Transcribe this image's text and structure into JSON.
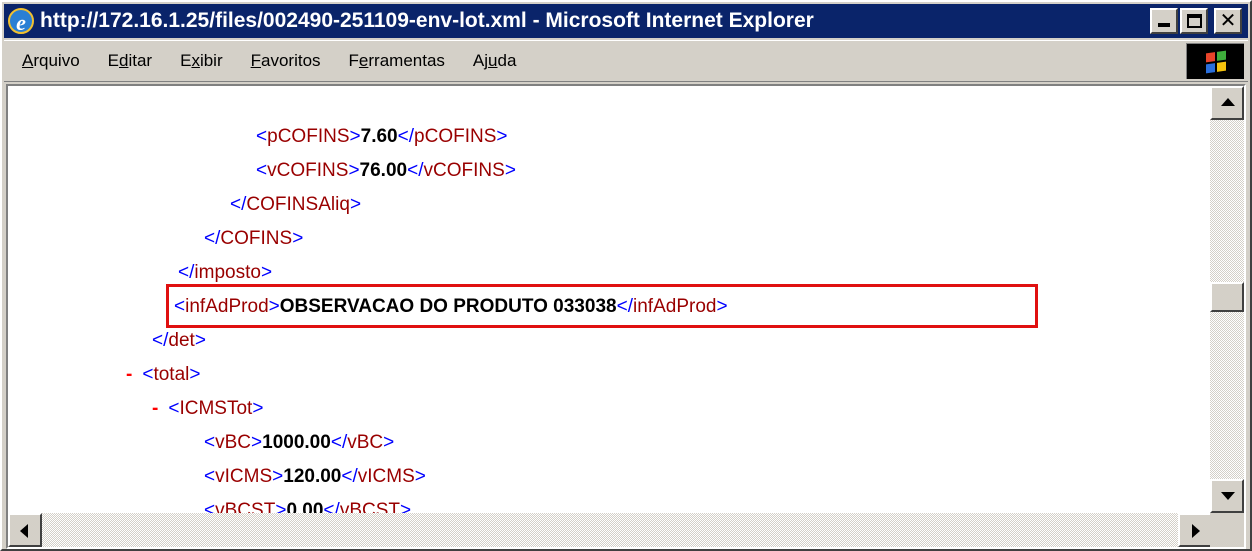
{
  "window": {
    "title": "http://172.16.1.25/files/002490-251109-env-lot.xml - Microsoft Internet Explorer"
  },
  "menu": {
    "items": [
      {
        "pre": "",
        "key": "A",
        "post": "rquivo"
      },
      {
        "pre": "E",
        "key": "d",
        "post": "itar"
      },
      {
        "pre": "E",
        "key": "x",
        "post": "ibir"
      },
      {
        "pre": "",
        "key": "F",
        "post": "avoritos"
      },
      {
        "pre": "F",
        "key": "e",
        "post": "rramentas"
      },
      {
        "pre": "Aj",
        "key": "u",
        "post": "da"
      }
    ]
  },
  "xml": {
    "pcofins": {
      "open": "<pCOFINS>",
      "value": "7.60",
      "close": "</pCOFINS>"
    },
    "vcofins": {
      "open": "<vCOFINS>",
      "value": "76.00",
      "close": "</vCOFINS>"
    },
    "cofinsaliq_close": "</COFINSAliq>",
    "cofins_close": "</COFINS>",
    "imposto_close": "</imposto>",
    "infadprod": {
      "open": "<infAdProd>",
      "value": "OBSERVACAO DO PRODUTO 033038",
      "close": "</infAdProd>"
    },
    "det_close": "</det>",
    "collapse_marker": "-",
    "total_open": "<total>",
    "icmstot_open": "<ICMSTot>",
    "vbc": {
      "open": "<vBC>",
      "value": "1000.00",
      "close": "</vBC>"
    },
    "vicms": {
      "open": "<vICMS>",
      "value": "120.00",
      "close": "</vICMS>"
    },
    "vbcst": {
      "open": "<vBCST>",
      "value": "0.00",
      "close": "</vBCST>"
    }
  },
  "colors": {
    "titlebar": "#0a246a",
    "tag_name": "#990000",
    "tag_bracket": "#0000ff",
    "highlight": "#e01010",
    "collapse": "#ff0000"
  }
}
